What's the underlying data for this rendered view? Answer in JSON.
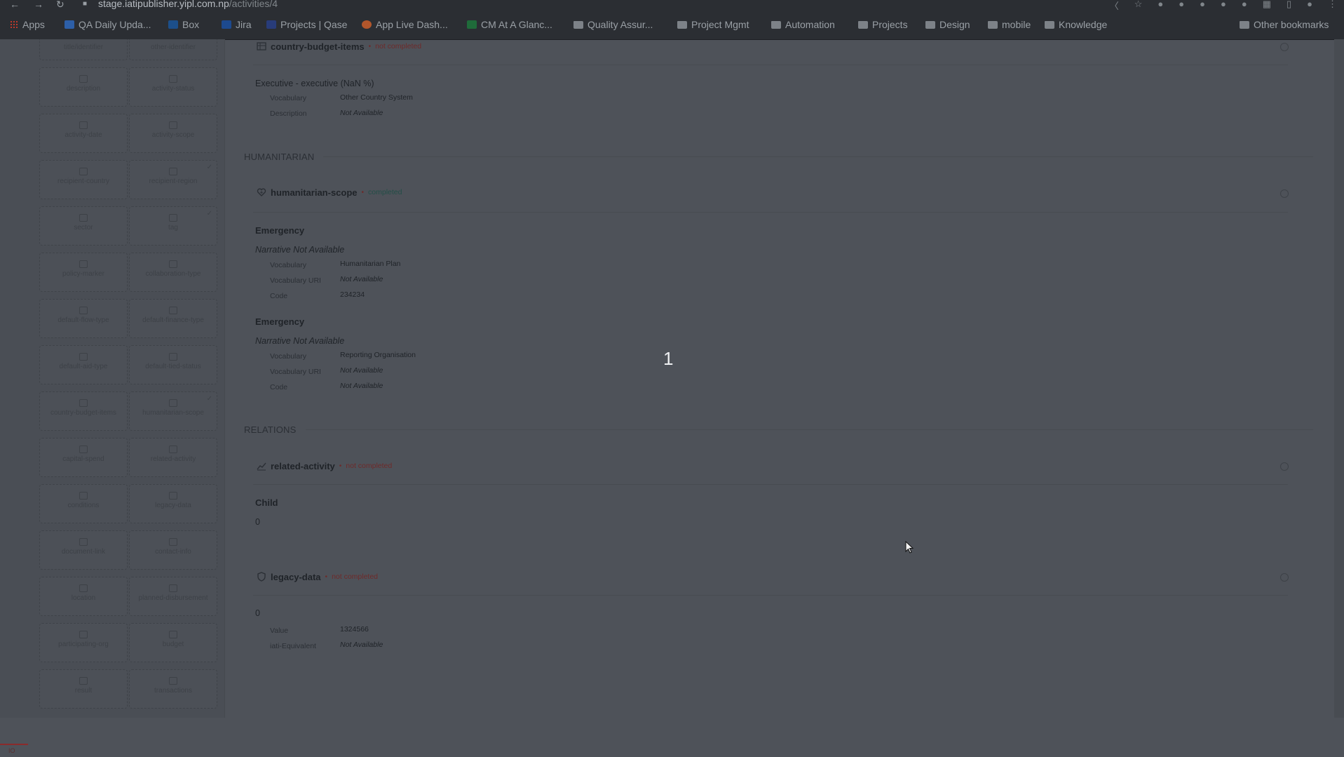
{
  "browser": {
    "url_host": "stage.iatipublisher.yipl.com.np",
    "url_path": "/activities/4",
    "bookmarks": [
      {
        "label": "Apps",
        "icon": "apps-grid-icon"
      },
      {
        "label": "QA Daily Upda...",
        "icon": "doc-icon"
      },
      {
        "label": "Box",
        "icon": "box-icon"
      },
      {
        "label": "Jira",
        "icon": "jira-icon"
      },
      {
        "label": "Projects | Qase",
        "icon": "qase-icon"
      },
      {
        "label": "App Live Dash...",
        "icon": "chrome-icon"
      },
      {
        "label": "CM At A Glanc...",
        "icon": "sheet-icon"
      },
      {
        "label": "Quality Assur...",
        "icon": "folder-icon"
      },
      {
        "label": "Project Mgmt",
        "icon": "folder-icon"
      },
      {
        "label": "Automation",
        "icon": "folder-icon"
      },
      {
        "label": "Projects",
        "icon": "folder-icon"
      },
      {
        "label": "Design",
        "icon": "folder-icon"
      },
      {
        "label": "mobile",
        "icon": "folder-icon"
      },
      {
        "label": "Knowledge",
        "icon": "folder-icon"
      }
    ],
    "other_bookmarks": "Other bookmarks"
  },
  "sidebar": {
    "top_tiles": [
      "title/identifier",
      "other-identifier"
    ],
    "tiles": [
      {
        "label": "description",
        "checked": false
      },
      {
        "label": "activity-status",
        "checked": false
      },
      {
        "label": "activity-date",
        "checked": false
      },
      {
        "label": "activity-scope",
        "checked": false
      },
      {
        "label": "recipient-country",
        "checked": false
      },
      {
        "label": "recipient-region",
        "checked": true
      },
      {
        "label": "sector",
        "checked": false
      },
      {
        "label": "tag",
        "checked": true
      },
      {
        "label": "policy-marker",
        "checked": false
      },
      {
        "label": "collaboration-type",
        "checked": false
      },
      {
        "label": "default-flow-type",
        "checked": false
      },
      {
        "label": "default-finance-type",
        "checked": false
      },
      {
        "label": "default-aid-type",
        "checked": false
      },
      {
        "label": "default-tied-status",
        "checked": false
      },
      {
        "label": "country-budget-items",
        "checked": false
      },
      {
        "label": "humanitarian-scope",
        "checked": true
      },
      {
        "label": "capital-spend",
        "checked": false
      },
      {
        "label": "related-activity",
        "checked": false
      },
      {
        "label": "conditions",
        "checked": false
      },
      {
        "label": "legacy-data",
        "checked": false
      },
      {
        "label": "document-link",
        "checked": false
      },
      {
        "label": "contact-info",
        "checked": false
      },
      {
        "label": "location",
        "checked": false
      },
      {
        "label": "planned-disbursement",
        "checked": false
      },
      {
        "label": "participating-org",
        "checked": false
      },
      {
        "label": "budget",
        "checked": false
      },
      {
        "label": "result",
        "checked": false
      },
      {
        "label": "transactions",
        "checked": false
      }
    ],
    "marker_text": "IO"
  },
  "main": {
    "country_budget_items": {
      "title": "country-budget-items",
      "status": "not completed",
      "heading": "Executive - executive (NaN %)",
      "vocabulary_key": "Vocabulary",
      "vocabulary_val": "Other Country System",
      "description_key": "Description",
      "description_val": "Not Available"
    },
    "section_humanitarian": "HUMANITARIAN",
    "humanitarian_scope": {
      "title": "humanitarian-scope",
      "status": "completed",
      "items": [
        {
          "heading": "Emergency",
          "narrative": "Narrative Not Available",
          "vocab_key": "Vocabulary",
          "vocab_val": "Humanitarian Plan",
          "uri_key": "Vocabulary URI",
          "uri_val": "Not Available",
          "code_key": "Code",
          "code_val": "234234"
        },
        {
          "heading": "Emergency",
          "narrative": "Narrative Not Available",
          "vocab_key": "Vocabulary",
          "vocab_val": "Reporting Organisation",
          "uri_key": "Vocabulary URI",
          "uri_val": "Not Available",
          "code_key": "Code",
          "code_val": "Not Available"
        }
      ]
    },
    "section_relations": "RELATIONS",
    "related_activity": {
      "title": "related-activity",
      "status": "not completed",
      "heading": "Child",
      "value": "0"
    },
    "legacy_data": {
      "title": "legacy-data",
      "status": "not completed",
      "value": "0",
      "value_key": "Value",
      "value_val": "1324566",
      "iati_key": "iati-Equivalent",
      "iati_val": "Not Available"
    },
    "overlay_number": "1"
  }
}
